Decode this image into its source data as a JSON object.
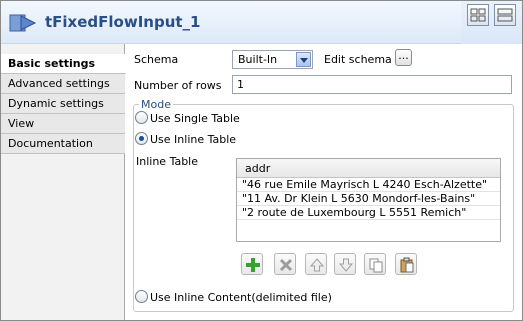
{
  "title": {
    "text": "tFixedFlowInput_1"
  },
  "tabs": [
    {
      "label": "Basic settings",
      "active": true
    },
    {
      "label": "Advanced settings"
    },
    {
      "label": "Dynamic settings"
    },
    {
      "label": "View"
    },
    {
      "label": "Documentation"
    }
  ],
  "schema": {
    "label": "Schema",
    "value": "Built-In",
    "edit_label": "Edit schema",
    "edit_button": "..."
  },
  "rows": {
    "label": "Number of rows",
    "value": "1"
  },
  "mode": {
    "legend": "Mode",
    "options": [
      {
        "label": "Use Single Table",
        "checked": false
      },
      {
        "label": "Use Inline Table",
        "checked": true
      },
      {
        "label": "Use Inline Content(delimited file)",
        "checked": false
      }
    ]
  },
  "inline_table": {
    "label": "Inline Table",
    "header": "addr",
    "rows": [
      "\"46 rue Emile Mayrisch L 4240 Esch-Alzette\"",
      "\"11 Av. Dr Klein L 5630 Mondorf-les-Bains\"",
      "\"2 route de Luxembourg L 5551 Remich\""
    ]
  },
  "toolbar": [
    "add-icon",
    "remove-icon",
    "move-up-icon",
    "move-down-icon",
    "copy-icon",
    "paste-icon"
  ]
}
